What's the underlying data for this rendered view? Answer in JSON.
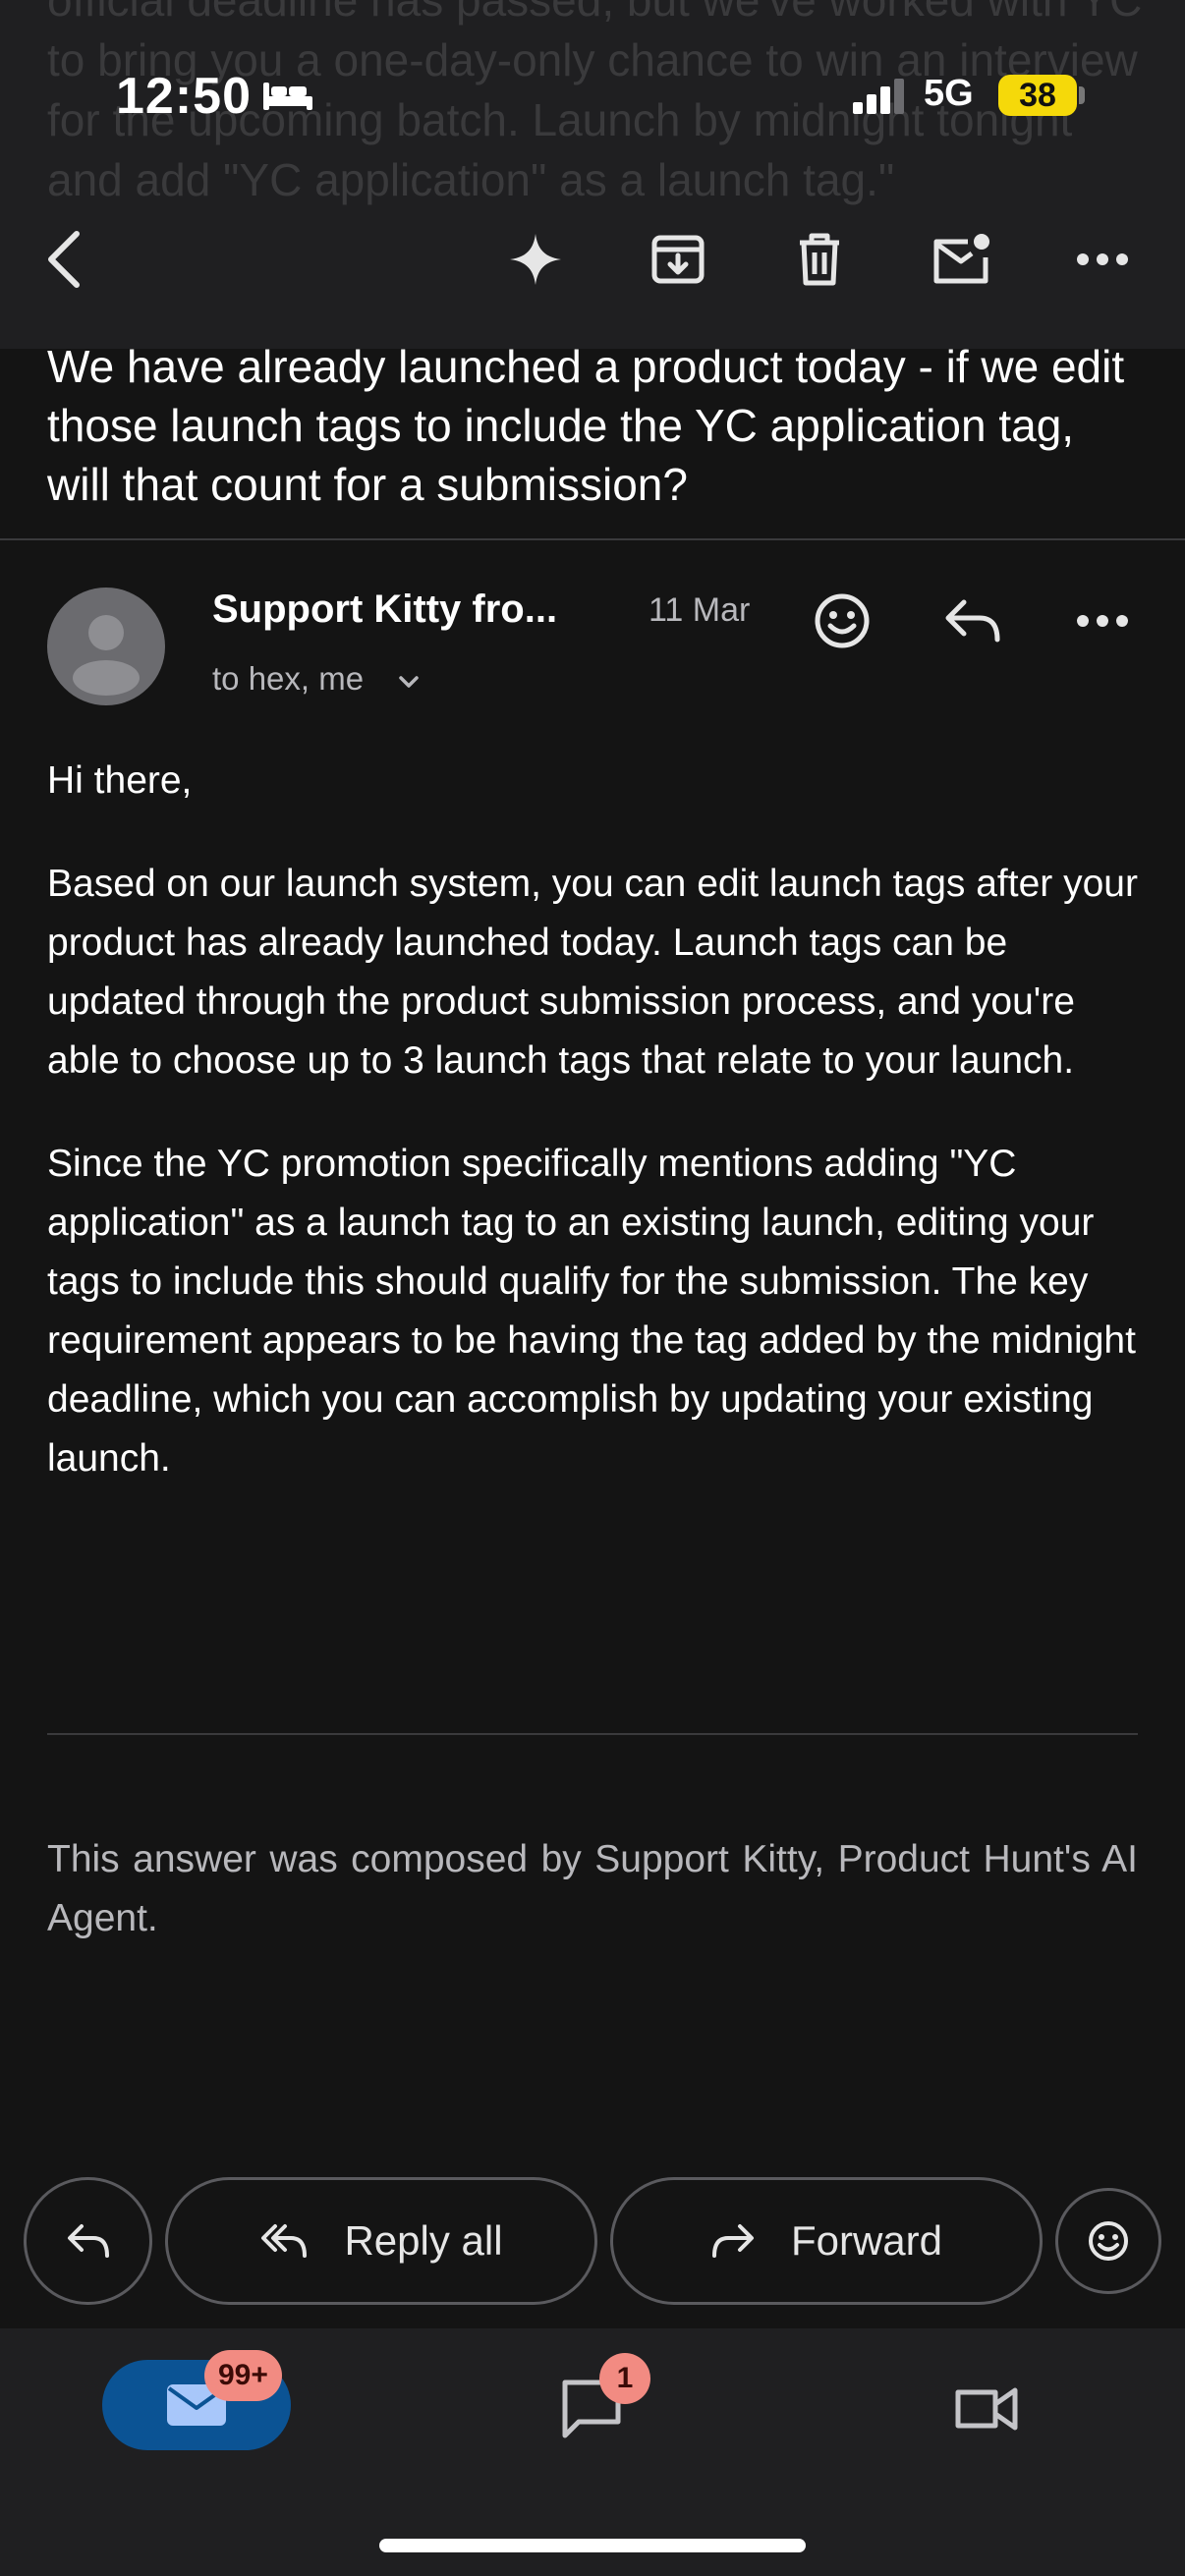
{
  "status_bar": {
    "time": "12:50",
    "network": "5G",
    "battery": "38"
  },
  "ghost_text": "official deadline has passed, but we've worked with YC to bring you a one-day-only chance to win an interview for the upcoming batch. Launch by midnight tonight and add \"YC application\" as a launch tag.\"",
  "toolbar": {
    "icons": [
      "back-icon",
      "sparkle-icon",
      "archive-icon",
      "trash-icon",
      "mark-unread-icon",
      "more-icon"
    ]
  },
  "email": {
    "subject": "We have already launched a product today - if we edit those launch tags to include the YC application tag, will that count for a submission?",
    "sender": "Support Kitty fro...",
    "date": "11 Mar",
    "recipients": "to hex, me",
    "greeting": "Hi there,",
    "paragraphs": [
      "Based on our launch system, you can edit launch tags after your product has already launched today. Launch tags can be updated through the product submission process, and you're able to choose up to 3 launch tags that relate to your launch.",
      "Since the YC promotion specifically mentions adding \"YC application\" as a launch tag to an existing launch, editing your tags to include this should qualify for the submission. The key requirement appears to be having the tag added by the midnight deadline, which you can accomplish by updating your existing launch."
    ],
    "footer_note": "This answer was composed by Support Kitty, Product Hunt's AI Agent."
  },
  "actions": {
    "reply_all_label": "Reply all",
    "forward_label": "Forward"
  },
  "bottom_nav": {
    "mail_badge": "99+",
    "chat_badge": "1"
  },
  "colors": {
    "background": "#141414",
    "toolbar": "#1f1f21",
    "mail_pill": "#0b5394",
    "badge": "#f28b82",
    "battery": "#f5d90a"
  }
}
